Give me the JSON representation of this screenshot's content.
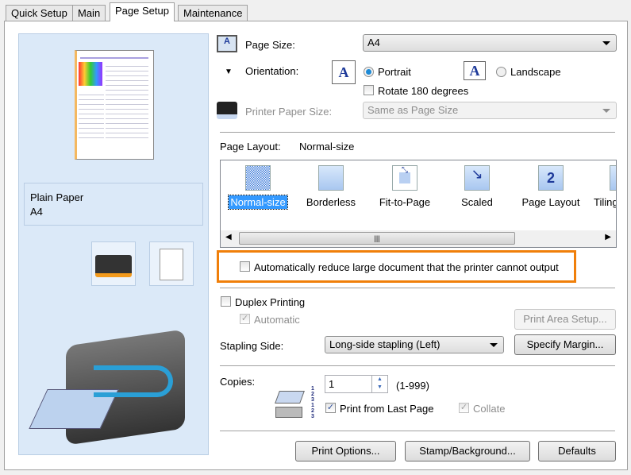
{
  "tabs": [
    {
      "label": "Quick Setup"
    },
    {
      "label": "Main"
    },
    {
      "label": "Page Setup",
      "active": true
    },
    {
      "label": "Maintenance"
    }
  ],
  "preview": {
    "media_type": "Plain Paper",
    "paper_size": "A4"
  },
  "page_size": {
    "label": "Page Size:",
    "value": "A4"
  },
  "orientation": {
    "label": "Orientation:",
    "portrait": "Portrait",
    "landscape": "Landscape",
    "selected": "Portrait",
    "rotate_label": "Rotate 180 degrees",
    "rotate_checked": false
  },
  "printer_paper_size": {
    "label": "Printer Paper Size:",
    "value": "Same as Page Size",
    "enabled": false
  },
  "page_layout": {
    "label": "Page Layout:",
    "value": "Normal-size",
    "items": [
      {
        "label": "Normal-size",
        "selected": true
      },
      {
        "label": "Borderless"
      },
      {
        "label": "Fit-to-Page"
      },
      {
        "label": "Scaled"
      },
      {
        "label": "Page Layout"
      },
      {
        "label": "Tiling"
      }
    ],
    "icon_digit": "2"
  },
  "auto_reduce": {
    "label": "Automatically reduce large document that the printer cannot output",
    "checked": false,
    "highlight_color": "#f07f0a"
  },
  "duplex": {
    "label": "Duplex Printing",
    "checked": false,
    "automatic_label": "Automatic",
    "automatic_checked": true,
    "print_area_button": "Print Area Setup..."
  },
  "stapling": {
    "label": "Stapling Side:",
    "value": "Long-side stapling (Left)",
    "margin_button": "Specify Margin..."
  },
  "copies": {
    "label": "Copies:",
    "value": "1",
    "range": "(1-999)",
    "print_last_label": "Print from Last Page",
    "print_last_checked": true,
    "collate_label": "Collate",
    "collate_checked": true
  },
  "buttons": {
    "print_options": "Print Options...",
    "stamp": "Stamp/Background...",
    "defaults": "Defaults"
  }
}
